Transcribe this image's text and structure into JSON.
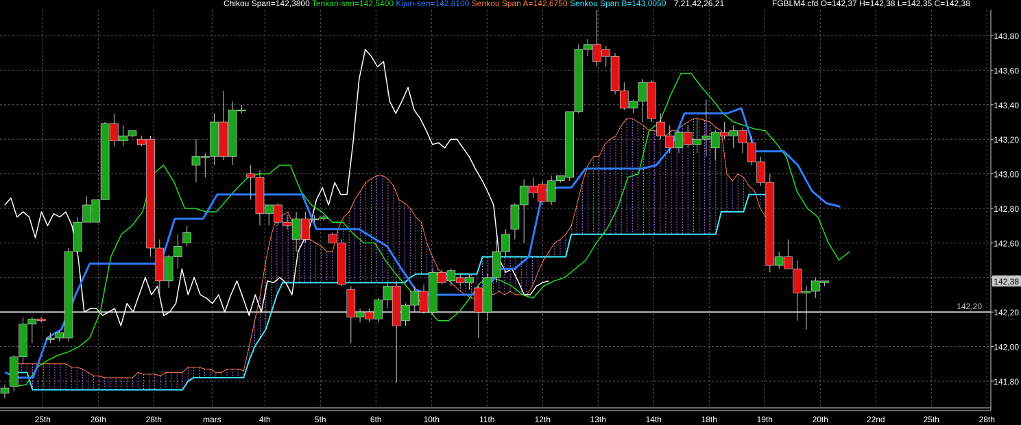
{
  "legend": {
    "chikou": "Chikou Span=142,3800",
    "tenkan": "Tenkan-sen=142,5400",
    "kijun": "Kijun-sen=142,8100",
    "senkou_a": "Senkou Span A=142,6750",
    "senkou_b": "Senkou Span B=143,0050",
    "params": "7,21,42,26,21",
    "ohlc": "FGBLM4.cfd O=142,37 H=142,38 L=142,35 C=142,38"
  },
  "colors": {
    "background": "#000000",
    "grid": "#5a5a5a",
    "up_candle": "#1fa31f",
    "down_candle": "#e01414",
    "wick": "#c8c8c8",
    "chikou": "#ffffff",
    "tenkan": "#22dd22",
    "kijun": "#2f7bff",
    "senkou_a": "#ff7a45",
    "senkou_b": "#3fe6ff",
    "cloud_hatch": "#b070ff",
    "price_line": "#c8c8c8",
    "axis_text": "#ffffff"
  },
  "chart_data": {
    "type": "candlestick",
    "instrument": "FGBLM4.cfd",
    "y_axis": {
      "ticks": [
        141.8,
        142.0,
        142.2,
        142.4,
        142.6,
        142.8,
        143.0,
        143.2,
        143.4,
        143.6,
        143.8
      ],
      "tick_labels": [
        "141,80",
        "142,00",
        "142,20",
        "142,40",
        "142,60",
        "142,80",
        "143,00",
        "143,20",
        "143,40",
        "143,60",
        "143,80"
      ],
      "range": [
        141.7,
        143.95
      ]
    },
    "x_axis": {
      "labels": [
        "25th",
        "26th",
        "28th",
        "mars",
        "4th",
        "5th",
        "6th",
        "10th",
        "11th",
        "12th",
        "13th",
        "14th",
        "18th",
        "19th",
        "20th",
        "22nd",
        "25th",
        "28th"
      ],
      "label_bar_index": [
        2.5,
        12.5,
        22.5,
        33,
        42.5,
        52.5,
        62.5,
        72.5,
        82.5,
        92.5,
        102.5,
        112.5,
        122.5,
        132.5,
        142.5,
        152.5,
        162.5,
        172.5
      ],
      "bar_count_total": 177
    },
    "grid": true,
    "current_price_label": "142,38",
    "current_price": 142.38,
    "horizontal_line_label": "142,20",
    "horizontal_line": 142.2,
    "candles": [
      {
        "o": 141.73,
        "h": 141.78,
        "l": 141.7,
        "c": 141.76
      },
      {
        "o": 141.77,
        "h": 141.95,
        "l": 141.74,
        "c": 141.94
      },
      {
        "o": 141.94,
        "h": 142.17,
        "l": 141.9,
        "c": 142.13
      },
      {
        "o": 142.13,
        "h": 142.17,
        "l": 142.02,
        "c": 142.16
      },
      {
        "o": 142.16,
        "h": 142.17,
        "l": 142.14,
        "c": 142.15
      },
      {
        "o": 142.04,
        "h": 142.08,
        "l": 142.02,
        "c": 142.05
      },
      {
        "o": 142.05,
        "h": 142.09,
        "l": 142.03,
        "c": 142.08
      },
      {
        "o": 142.05,
        "h": 142.57,
        "l": 142.03,
        "c": 142.55
      },
      {
        "o": 142.55,
        "h": 142.75,
        "l": 142.52,
        "c": 142.72
      },
      {
        "o": 142.72,
        "h": 142.87,
        "l": 142.72,
        "c": 142.82
      },
      {
        "o": 142.72,
        "h": 142.82,
        "l": 142.72,
        "c": 142.85
      },
      {
        "o": 142.85,
        "h": 143.3,
        "l": 142.85,
        "c": 143.29
      },
      {
        "o": 143.29,
        "h": 143.35,
        "l": 143.16,
        "c": 143.19
      },
      {
        "o": 143.19,
        "h": 143.28,
        "l": 143.16,
        "c": 143.22
      },
      {
        "o": 143.22,
        "h": 143.25,
        "l": 143.21,
        "c": 143.25
      },
      {
        "o": 143.2,
        "h": 143.22,
        "l": 143.16,
        "c": 143.17
      },
      {
        "o": 143.2,
        "h": 143.22,
        "l": 142.52,
        "c": 142.57
      },
      {
        "o": 142.57,
        "h": 142.62,
        "l": 142.28,
        "c": 142.38
      },
      {
        "o": 142.38,
        "h": 142.53,
        "l": 142.34,
        "c": 142.52
      },
      {
        "o": 142.52,
        "h": 142.65,
        "l": 142.45,
        "c": 142.58
      },
      {
        "o": 142.6,
        "h": 142.7,
        "l": 142.58,
        "c": 142.66
      },
      {
        "o": 143.05,
        "h": 143.2,
        "l": 142.95,
        "c": 143.1
      },
      {
        "o": 143.1,
        "h": 143.12,
        "l": 142.98,
        "c": 143.1
      },
      {
        "o": 143.1,
        "h": 143.35,
        "l": 143.05,
        "c": 143.3
      },
      {
        "o": 143.3,
        "h": 143.48,
        "l": 143.08,
        "c": 143.1
      },
      {
        "o": 143.1,
        "h": 143.42,
        "l": 143.05,
        "c": 143.37
      },
      {
        "o": 143.37,
        "h": 143.4,
        "l": 143.35,
        "c": 143.37
      },
      {
        "o": 143.0,
        "h": 143.05,
        "l": 142.85,
        "c": 142.98
      },
      {
        "o": 142.98,
        "h": 143.02,
        "l": 142.7,
        "c": 142.77
      },
      {
        "o": 142.77,
        "h": 142.82,
        "l": 142.7,
        "c": 142.82
      },
      {
        "o": 142.82,
        "h": 142.83,
        "l": 142.7,
        "c": 142.72
      },
      {
        "o": 142.72,
        "h": 142.76,
        "l": 142.68,
        "c": 142.7
      },
      {
        "o": 142.62,
        "h": 142.78,
        "l": 142.55,
        "c": 142.74
      },
      {
        "o": 142.74,
        "h": 142.78,
        "l": 142.6,
        "c": 142.62
      },
      {
        "o": 142.74,
        "h": 142.76,
        "l": 142.72,
        "c": 142.74
      },
      {
        "o": 142.74,
        "h": 142.76,
        "l": 142.73,
        "c": 142.75
      },
      {
        "o": 142.65,
        "h": 142.66,
        "l": 142.6,
        "c": 142.6
      },
      {
        "o": 142.6,
        "h": 142.62,
        "l": 142.35,
        "c": 142.36
      },
      {
        "o": 142.33,
        "h": 142.35,
        "l": 142.02,
        "c": 142.17
      },
      {
        "o": 142.17,
        "h": 142.22,
        "l": 142.14,
        "c": 142.2
      },
      {
        "o": 142.2,
        "h": 142.22,
        "l": 142.14,
        "c": 142.16
      },
      {
        "o": 142.16,
        "h": 142.28,
        "l": 142.14,
        "c": 142.27
      },
      {
        "o": 142.27,
        "h": 142.37,
        "l": 142.22,
        "c": 142.35
      },
      {
        "o": 142.35,
        "h": 142.38,
        "l": 141.79,
        "c": 142.12
      },
      {
        "o": 142.15,
        "h": 142.25,
        "l": 142.12,
        "c": 142.24
      },
      {
        "o": 142.24,
        "h": 142.35,
        "l": 142.2,
        "c": 142.32
      },
      {
        "o": 142.32,
        "h": 142.36,
        "l": 142.19,
        "c": 142.2
      },
      {
        "o": 142.2,
        "h": 142.45,
        "l": 142.18,
        "c": 142.43
      },
      {
        "o": 142.43,
        "h": 142.45,
        "l": 142.36,
        "c": 142.37
      },
      {
        "o": 142.38,
        "h": 142.45,
        "l": 142.35,
        "c": 142.44
      },
      {
        "o": 142.4,
        "h": 142.42,
        "l": 142.35,
        "c": 142.37
      },
      {
        "o": 142.37,
        "h": 142.42,
        "l": 142.33,
        "c": 142.4
      },
      {
        "o": 142.34,
        "h": 142.36,
        "l": 142.05,
        "c": 142.2
      },
      {
        "o": 142.2,
        "h": 142.42,
        "l": 142.15,
        "c": 142.4
      },
      {
        "o": 142.4,
        "h": 142.62,
        "l": 142.37,
        "c": 142.55
      },
      {
        "o": 142.55,
        "h": 142.68,
        "l": 142.52,
        "c": 142.65
      },
      {
        "o": 142.68,
        "h": 142.83,
        "l": 142.62,
        "c": 142.82
      },
      {
        "o": 142.82,
        "h": 142.97,
        "l": 142.6,
        "c": 142.93
      },
      {
        "o": 142.93,
        "h": 142.98,
        "l": 142.86,
        "c": 142.89
      },
      {
        "o": 142.94,
        "h": 142.96,
        "l": 142.82,
        "c": 142.84
      },
      {
        "o": 142.84,
        "h": 142.99,
        "l": 142.82,
        "c": 142.96
      },
      {
        "o": 142.96,
        "h": 142.99,
        "l": 142.95,
        "c": 142.99
      },
      {
        "o": 142.98,
        "h": 143.35,
        "l": 142.96,
        "c": 143.36
      },
      {
        "o": 143.36,
        "h": 143.75,
        "l": 143.35,
        "c": 143.72
      },
      {
        "o": 143.72,
        "h": 143.78,
        "l": 143.68,
        "c": 143.75
      },
      {
        "o": 143.75,
        "h": 143.95,
        "l": 143.62,
        "c": 143.65
      },
      {
        "o": 143.72,
        "h": 143.74,
        "l": 143.62,
        "c": 143.68
      },
      {
        "o": 143.68,
        "h": 143.7,
        "l": 143.46,
        "c": 143.48
      },
      {
        "o": 143.48,
        "h": 143.53,
        "l": 143.37,
        "c": 143.38
      },
      {
        "o": 143.38,
        "h": 143.43,
        "l": 143.35,
        "c": 143.42
      },
      {
        "o": 143.42,
        "h": 143.55,
        "l": 143.3,
        "c": 143.53
      },
      {
        "o": 143.53,
        "h": 143.54,
        "l": 143.3,
        "c": 143.32
      },
      {
        "o": 143.3,
        "h": 143.35,
        "l": 143.2,
        "c": 143.22
      },
      {
        "o": 143.22,
        "h": 143.28,
        "l": 143.12,
        "c": 143.15
      },
      {
        "o": 143.15,
        "h": 143.25,
        "l": 143.12,
        "c": 143.24
      },
      {
        "o": 143.24,
        "h": 143.28,
        "l": 143.15,
        "c": 143.17
      },
      {
        "o": 143.17,
        "h": 143.32,
        "l": 143.12,
        "c": 143.2
      },
      {
        "o": 143.2,
        "h": 143.43,
        "l": 143.1,
        "c": 143.22
      },
      {
        "o": 143.15,
        "h": 143.25,
        "l": 143.08,
        "c": 143.24
      },
      {
        "o": 143.24,
        "h": 143.3,
        "l": 143.2,
        "c": 143.22
      },
      {
        "o": 143.22,
        "h": 143.28,
        "l": 143.15,
        "c": 143.25
      },
      {
        "o": 143.25,
        "h": 143.27,
        "l": 143.12,
        "c": 143.18
      },
      {
        "o": 143.18,
        "h": 143.22,
        "l": 143.05,
        "c": 143.07
      },
      {
        "o": 143.07,
        "h": 143.1,
        "l": 142.93,
        "c": 142.95
      },
      {
        "o": 142.95,
        "h": 143.0,
        "l": 142.43,
        "c": 142.47
      },
      {
        "o": 142.47,
        "h": 142.55,
        "l": 142.45,
        "c": 142.52
      },
      {
        "o": 142.52,
        "h": 142.62,
        "l": 142.45,
        "c": 142.45
      },
      {
        "o": 142.45,
        "h": 142.5,
        "l": 142.15,
        "c": 142.31
      },
      {
        "o": 142.31,
        "h": 142.35,
        "l": 142.1,
        "c": 142.32
      },
      {
        "o": 142.32,
        "h": 142.4,
        "l": 142.28,
        "c": 142.38
      },
      {
        "o": 142.37,
        "h": 142.38,
        "l": 142.35,
        "c": 142.38
      }
    ],
    "series": [
      {
        "name": "Chikou Span",
        "values": [
          142.82,
          142.86,
          142.75,
          142.78,
          142.75,
          142.63,
          142.78,
          142.7,
          142.77,
          142.75,
          142.78,
          142.7,
          142.52,
          142.2,
          142.22,
          142.22,
          142.18,
          142.2,
          142.22,
          142.12,
          142.25,
          142.2,
          142.3,
          142.4,
          142.3,
          142.35,
          142.18,
          142.2,
          142.25,
          142.45,
          142.3,
          142.4,
          142.3,
          142.28,
          142.25,
          142.3,
          142.2,
          142.3,
          142.38,
          142.28,
          142.18,
          142.3,
          142.2,
          142.38,
          142.37,
          142.4,
          142.37,
          142.3,
          142.55,
          142.62,
          142.7,
          142.85,
          142.92,
          142.82,
          142.95,
          142.88,
          142.88,
          143.18,
          143.55,
          143.72,
          143.68,
          143.62,
          143.65,
          143.42,
          143.35,
          143.42,
          143.5,
          143.37,
          143.32,
          143.25,
          143.17,
          143.18,
          143.15,
          143.2,
          143.2,
          143.15,
          143.1,
          143.03,
          142.97,
          142.9,
          142.82,
          142.5,
          142.43,
          142.45,
          142.38,
          142.3,
          142.3,
          142.35,
          142.37,
          142.38
        ],
        "color": "#ffffff"
      },
      {
        "name": "Tenkan-sen",
        "values": [
          141.77,
          141.78,
          141.88,
          141.92,
          141.95,
          141.97,
          142.0,
          142.05,
          142.2,
          142.52,
          142.65,
          142.7,
          142.78,
          143.0,
          143.05,
          142.95,
          142.8,
          142.8,
          142.78,
          142.78,
          142.85,
          142.92,
          142.98,
          143.0,
          143.0,
          143.05,
          143.05,
          142.9,
          142.82,
          142.78,
          142.72,
          142.72,
          142.65,
          142.6,
          142.6,
          142.5,
          142.42,
          142.35,
          142.28,
          142.22,
          142.15,
          142.15,
          142.2,
          142.28,
          142.37,
          142.4,
          142.38,
          142.35,
          142.3,
          142.28,
          142.35,
          142.38,
          142.4,
          142.45,
          142.5,
          142.6,
          142.68,
          142.8,
          142.98,
          143.0,
          143.25,
          143.3,
          143.45,
          143.58,
          143.58,
          143.5,
          143.43,
          143.35,
          143.3,
          143.28,
          143.26,
          143.25,
          143.18,
          143.1,
          142.9,
          142.8,
          142.75,
          142.6,
          142.5,
          142.55
        ],
        "color": "#22dd22"
      },
      {
        "name": "Kijun-sen",
        "values": [
          141.85,
          141.82,
          141.82,
          142.05,
          142.1,
          142.3,
          142.48,
          142.48,
          142.48,
          142.48,
          142.48,
          142.48,
          142.74,
          142.74,
          142.74,
          142.88,
          142.88,
          142.88,
          142.88,
          142.88,
          142.88,
          142.88,
          142.68,
          142.68,
          142.68,
          142.68,
          142.63,
          142.58,
          142.45,
          142.33,
          142.3,
          142.3,
          142.3,
          142.3,
          142.33,
          142.45,
          142.45,
          142.52,
          142.9,
          142.92,
          142.92,
          143.03,
          143.03,
          143.03,
          143.03,
          143.03,
          143.05,
          143.15,
          143.35,
          143.35,
          143.35,
          143.35,
          143.38,
          143.13,
          143.13,
          143.13,
          143.05,
          142.9,
          142.83,
          142.81
        ],
        "color": "#2f7bff"
      }
    ]
  }
}
